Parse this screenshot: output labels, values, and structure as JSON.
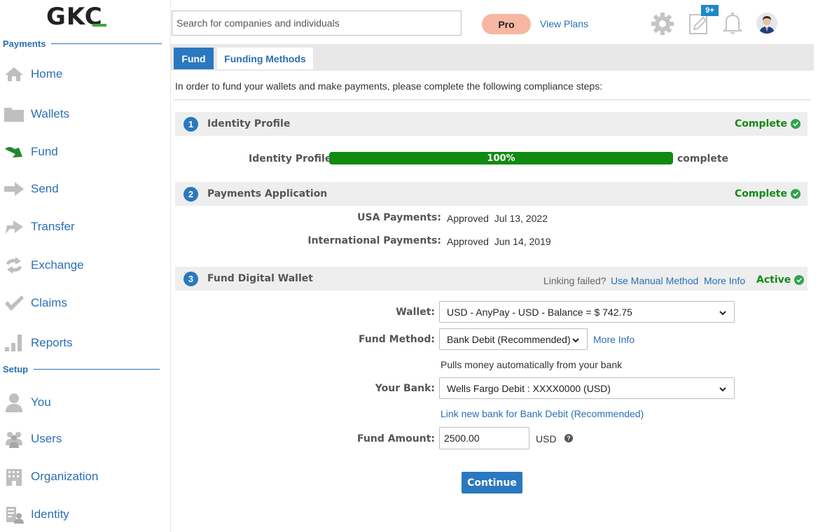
{
  "brand": {
    "logo": "GKC"
  },
  "header": {
    "search_placeholder": "Search for companies and individuals",
    "plan_badge": "Pro",
    "view_plans": "View Plans",
    "notes_badge": "9+"
  },
  "sidebar": {
    "sections": [
      {
        "title": "Payments",
        "items": [
          {
            "label": "Home",
            "icon": "home-icon"
          },
          {
            "label": "Wallets",
            "icon": "folder-icon"
          },
          {
            "label": "Fund",
            "icon": "fund-arrow-icon",
            "active": true
          },
          {
            "label": "Send",
            "icon": "send-arrow-icon"
          },
          {
            "label": "Transfer",
            "icon": "transfer-arrow-icon"
          },
          {
            "label": "Exchange",
            "icon": "exchange-icon"
          },
          {
            "label": "Claims",
            "icon": "checkmark-icon"
          },
          {
            "label": "Reports",
            "icon": "bar-chart-icon"
          }
        ]
      },
      {
        "title": "Setup",
        "items": [
          {
            "label": "You",
            "icon": "person-icon"
          },
          {
            "label": "Users",
            "icon": "users-icon"
          },
          {
            "label": "Organization",
            "icon": "building-icon"
          },
          {
            "label": "Identity",
            "icon": "identity-icon"
          }
        ]
      }
    ]
  },
  "tabs": [
    {
      "label": "Fund",
      "active": true
    },
    {
      "label": "Funding Methods",
      "active": false
    }
  ],
  "intro": "In order to fund your wallets and make payments, please complete the following compliance steps:",
  "steps": [
    {
      "num": "1",
      "title": "Identity Profile",
      "status": "Complete",
      "progress_label": "Identity Profile",
      "progress_value": "100%",
      "progress_fraction": 1.0,
      "progress_suffix": "complete"
    },
    {
      "num": "2",
      "title": "Payments Application",
      "status": "Complete",
      "rows": [
        {
          "label": "USA Payments:",
          "value": "Approved  Jul 13, 2022"
        },
        {
          "label": "International Payments:",
          "value": "Approved  Jun 14, 2019"
        }
      ]
    },
    {
      "num": "3",
      "title": "Fund Digital Wallet",
      "status": "Active",
      "linking_failed": "Linking failed?",
      "manual_method": "Use Manual Method",
      "more_info": "More Info"
    }
  ],
  "form": {
    "wallet_label": "Wallet:",
    "wallet_value": "USD - AnyPay - USD - Balance = $ 742.75",
    "method_label": "Fund Method:",
    "method_value": "Bank Debit (Recommended)",
    "method_more_info": "More Info",
    "method_hint": "Pulls money automatically from your bank",
    "bank_label": "Your Bank:",
    "bank_value": "Wells Fargo Debit : XXXX0000 (USD)",
    "link_bank": "Link new bank for Bank Debit (Recommended)",
    "amount_label": "Fund Amount:",
    "amount_value": "2500.00",
    "currency": "USD",
    "help_glyph": "?",
    "continue": "Continue"
  },
  "colors": {
    "accent": "#2a78bf",
    "link": "#2a6fb5",
    "success": "#138a13",
    "progress": "#118a11",
    "pro_badge": "#f7b7a3"
  }
}
